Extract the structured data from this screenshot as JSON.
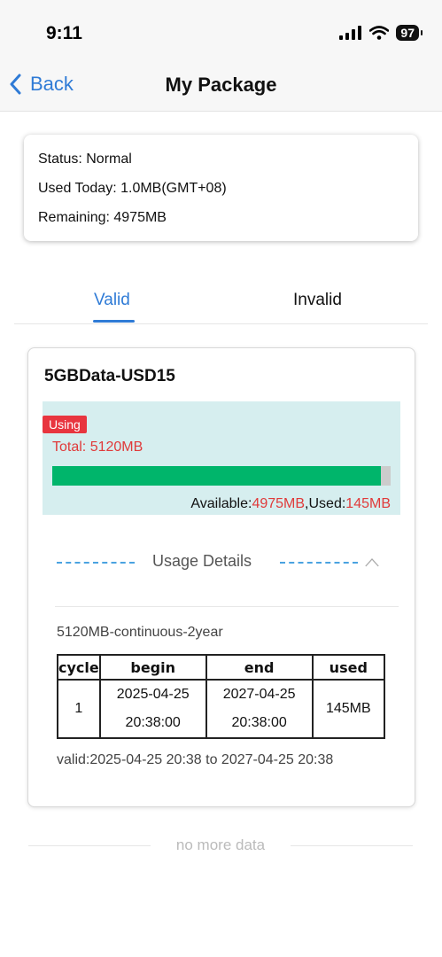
{
  "status_bar": {
    "time": "9:11",
    "battery": "97"
  },
  "nav": {
    "back_label": "Back",
    "title": "My Package"
  },
  "status_card": {
    "status": "Status: Normal",
    "used_today": "Used Today: 1.0MB(GMT+08)",
    "remaining": "Remaining: 4975MB"
  },
  "tabs": [
    {
      "label": "Valid",
      "active": true
    },
    {
      "label": "Invalid",
      "active": false
    }
  ],
  "package": {
    "name": "5GBData-USD15",
    "badge": "Using",
    "total": "Total: 5120MB",
    "used_fraction": 0.0283,
    "available_prefix": "Available:",
    "available_value": "4975MB",
    "used_prefix": ",Used:",
    "used_value": "145MB",
    "details_label": "Usage Details",
    "plan_label": "5120MB-continuous-2year",
    "table": {
      "headers": [
        "cycle",
        "begin",
        "end",
        "used"
      ],
      "rows": [
        {
          "cycle": "1",
          "begin_date": "2025-04-25",
          "begin_time": "20:38:00",
          "end_date": "2027-04-25",
          "end_time": "20:38:00",
          "used": "145MB"
        }
      ]
    },
    "valid_text": "valid:2025-04-25 20:38 to 2027-04-25 20:38"
  },
  "footer": {
    "no_more": "no more data"
  },
  "colors": {
    "accent": "#2f7bd6",
    "progress": "#00b56b",
    "alert": "#e03a3a",
    "usage_bg": "#d6eeef"
  }
}
